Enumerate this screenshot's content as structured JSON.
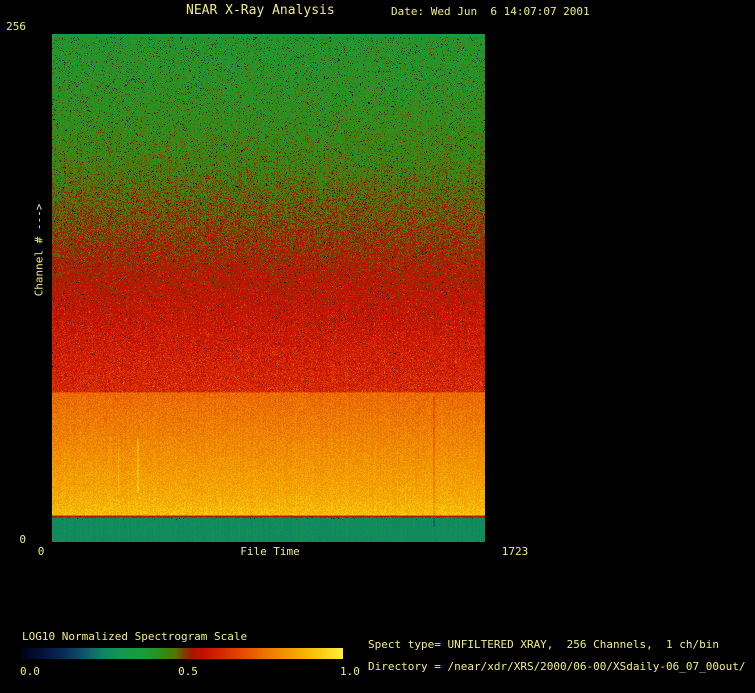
{
  "header": {
    "title": "NEAR X-Ray Analysis",
    "date": "Date: Wed Jun  6 14:07:07 2001"
  },
  "plot": {
    "y_axis": {
      "title": "Channel # --->",
      "max_label": "256",
      "min_label": "0"
    },
    "x_axis": {
      "title": "File Time",
      "min_label": "0",
      "max_label": "1723"
    }
  },
  "colorbar": {
    "title": "LOG10 Normalized Spectrogram Scale",
    "tick_labels": [
      "0.0",
      "0.5",
      "1.0"
    ]
  },
  "info": {
    "spect_type": "Spect type= UNFILTERED XRAY,  256 Channels,  1 ch/bin",
    "directory": "Directory = /near/xdr/XRS/2000/06-00/XSdaily-06_07_00out/"
  },
  "colors": {
    "background": "#000000",
    "text": "#f1ed85"
  },
  "chart_data": {
    "type": "heatmap",
    "title": "NEAR X-Ray Analysis",
    "xlabel": "File Time",
    "ylabel": "Channel # --->",
    "xlim": [
      0,
      1723
    ],
    "ylim": [
      0,
      256
    ],
    "grid": false,
    "legend": "none",
    "colorbar_label": "LOG10 Normalized Spectrogram Scale",
    "colorbar_range": [
      0.0,
      1.0
    ],
    "colorbar_ticks": [
      0.0,
      0.5,
      1.0
    ],
    "colormap_stops": [
      {
        "pos": 0.0,
        "color": "#02021a"
      },
      {
        "pos": 0.06,
        "color": "#051038"
      },
      {
        "pos": 0.13,
        "color": "#082c58"
      },
      {
        "pos": 0.19,
        "color": "#0c5468"
      },
      {
        "pos": 0.25,
        "color": "#108462"
      },
      {
        "pos": 0.31,
        "color": "#14984e"
      },
      {
        "pos": 0.38,
        "color": "#1c9c38"
      },
      {
        "pos": 0.44,
        "color": "#2e8c16"
      },
      {
        "pos": 0.48,
        "color": "#567400"
      },
      {
        "pos": 0.505,
        "color": "#7c3c00"
      },
      {
        "pos": 0.53,
        "color": "#a81400"
      },
      {
        "pos": 0.57,
        "color": "#c81000"
      },
      {
        "pos": 0.63,
        "color": "#d62c00"
      },
      {
        "pos": 0.7,
        "color": "#e65200"
      },
      {
        "pos": 0.78,
        "color": "#ee8000"
      },
      {
        "pos": 0.86,
        "color": "#f4a800"
      },
      {
        "pos": 0.93,
        "color": "#f9cc0e"
      },
      {
        "pos": 1.0,
        "color": "#ffee3c"
      }
    ],
    "channel_profile": {
      "comment": "approx LOG10 normalized intensity vs channel, read from colors",
      "channels": [
        256,
        224,
        192,
        160,
        128,
        100,
        76,
        75.4,
        56,
        40,
        24,
        14,
        12.4,
        0
      ],
      "values": [
        0.4,
        0.42,
        0.45,
        0.5,
        0.55,
        0.59,
        0.62,
        0.74,
        0.78,
        0.82,
        0.86,
        0.9,
        0.27,
        0.27
      ]
    },
    "top_strip": {
      "rows": 3,
      "value": 0.34
    },
    "band_boundary": {
      "channel": 12.6,
      "value": 0.5
    },
    "yellow_band_top_channel": 75.7,
    "noise": {
      "base_amplitude": 0.1,
      "yellow_band_amplitude": 0.08,
      "teal_amplitude": 0.03,
      "dark_speckle_max_probability": 0.05,
      "bright_spike_probability": 0.1
    },
    "features": [
      {
        "type": "bright-streak",
        "file_time": 338,
        "channel_range": [
          25,
          52
        ],
        "delta": 0.07,
        "width": 2
      },
      {
        "type": "bright-streak",
        "file_time": 263,
        "channel_range": [
          28,
          46
        ],
        "delta": 0.05,
        "width": 1
      },
      {
        "type": "dark-streak",
        "file_time": 1516,
        "channel_range": [
          8,
          73
        ],
        "delta": -0.05,
        "width": 2
      }
    ]
  }
}
